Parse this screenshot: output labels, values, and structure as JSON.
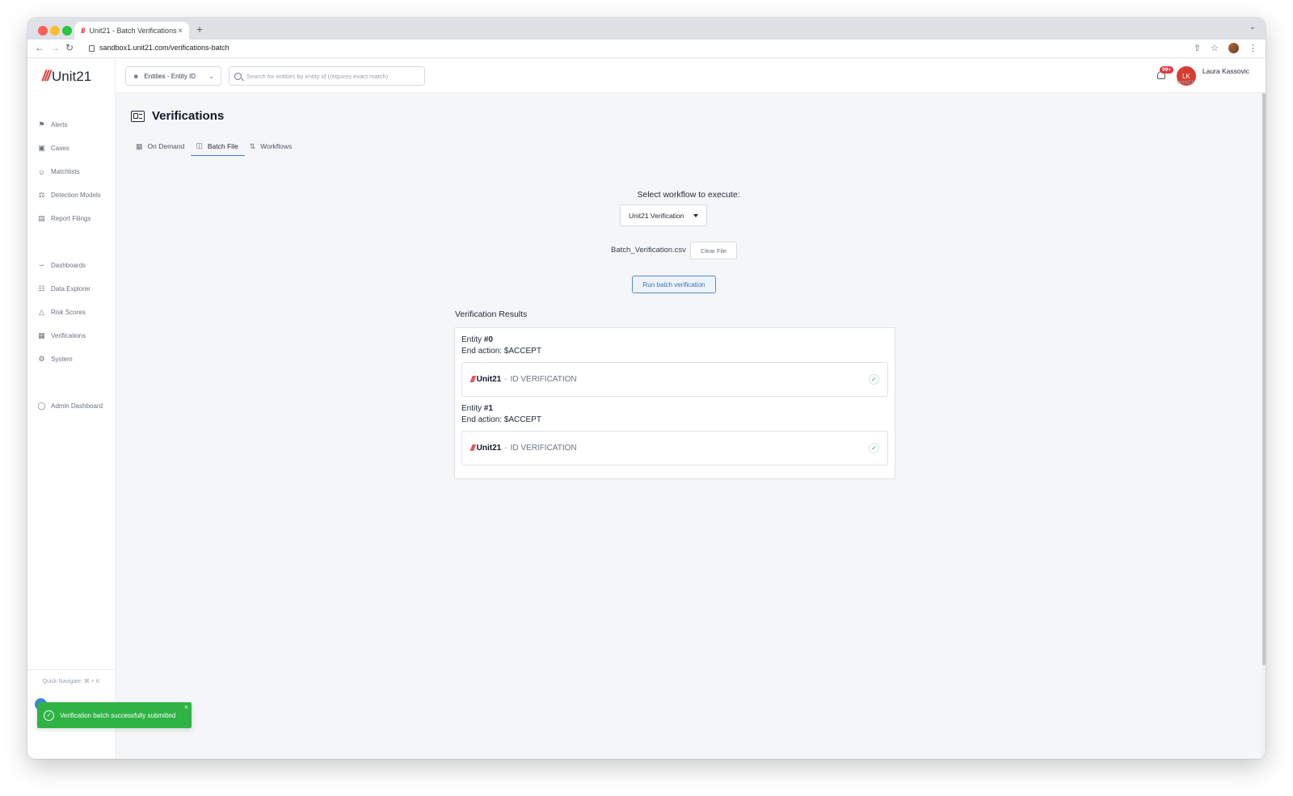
{
  "browser": {
    "tab_title": "Unit21 - Batch Verifications",
    "tab_favicon": "///",
    "tab_close": "×",
    "new_tab": "+",
    "url": "sandbox1.unit21.com/verifications-batch"
  },
  "app": {
    "logo_mark": "///",
    "logo_text": "Unit21"
  },
  "sidebar": {
    "items": [
      {
        "label": "Alerts",
        "icon": "flag-icon"
      },
      {
        "label": "Cases",
        "icon": "briefcase-icon"
      },
      {
        "label": "Matchlists",
        "icon": "user-plus-icon"
      },
      {
        "label": "Detection Models",
        "icon": "scale-icon"
      },
      {
        "label": "Report Filings",
        "icon": "archive-icon"
      },
      {
        "label": "Dashboards",
        "icon": "chart-icon"
      },
      {
        "label": "Data Explorer",
        "icon": "table-search-icon"
      },
      {
        "label": "Risk Scores",
        "icon": "warning-triangle-icon"
      },
      {
        "label": "Verifications",
        "icon": "id-card-icon"
      },
      {
        "label": "System",
        "icon": "gear-icon"
      },
      {
        "label": "Admin Dashboard",
        "icon": "globe-icon"
      }
    ],
    "quick_navigate": "Quick Navigate: ⌘ + K"
  },
  "header": {
    "entity_select": "Entities - Entity ID",
    "search_placeholder": "Search for entities by entity id (requires exact match)",
    "notification_count": "99+",
    "user_initials": "LK",
    "user_name": "Laura Kassovic",
    "user_org": "Unit21"
  },
  "page": {
    "title": "Verifications",
    "tabs": [
      {
        "label": "On Demand",
        "icon": "id-card-icon"
      },
      {
        "label": "Batch File",
        "icon": "file-icon",
        "active": true
      },
      {
        "label": "Workflows",
        "icon": "workflow-icon"
      }
    ],
    "workflow_label": "Select workflow to execute:",
    "workflow_selected": "Unit21 Verification",
    "file_name": "Batch_Verification.csv",
    "clear_file": "Clear File",
    "run_button": "Run batch verification",
    "results_title": "Verification Results",
    "results": [
      {
        "entity_prefix": "Entity ",
        "entity_number": "#0",
        "action_prefix": "End action: ",
        "action": "$ACCEPT",
        "brand": "Unit21",
        "separator": "-",
        "check_label": "ID VERIFICATION"
      },
      {
        "entity_prefix": "Entity ",
        "entity_number": "#1",
        "action_prefix": "End action: ",
        "action": "$ACCEPT",
        "brand": "Unit21",
        "separator": "-",
        "check_label": "ID VERIFICATION"
      }
    ]
  },
  "toast": {
    "message": "Verification batch successfully submitted",
    "close": "×"
  },
  "colors": {
    "brand_red": "#e0393e",
    "accent_blue": "#4a7bc8",
    "success_green": "#2fb344"
  }
}
